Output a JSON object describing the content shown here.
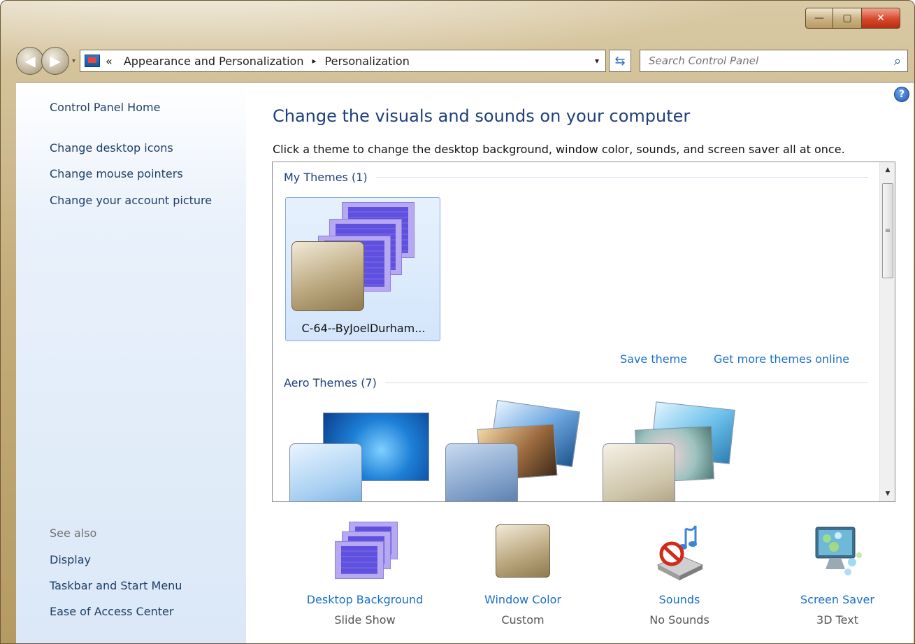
{
  "window": {
    "caption_min": "—",
    "caption_max": "▢",
    "caption_close": "✕"
  },
  "navbar": {
    "back_glyph": "◀",
    "forward_glyph": "▶",
    "history_glyph": "▾",
    "breadcrumb_overflow": "«",
    "breadcrumb": [
      "Appearance and Personalization",
      "Personalization"
    ],
    "breadcrumb_chevron": "▸",
    "address_dropdown_glyph": "▾",
    "refresh_glyph": "⇆",
    "search_placeholder": "Search Control Panel",
    "search_glyph": "⌕"
  },
  "sidebar": {
    "home": "Control Panel Home",
    "links": [
      "Change desktop icons",
      "Change mouse pointers",
      "Change your account picture"
    ],
    "see_also_label": "See also",
    "see_also": [
      "Display",
      "Taskbar and Start Menu",
      "Ease of Access Center"
    ]
  },
  "main": {
    "help_glyph": "?",
    "title": "Change the visuals and sounds on your computer",
    "instructions": "Click a theme to change the desktop background, window color, sounds, and screen saver all at once.",
    "my_themes": {
      "heading": "My Themes (1)",
      "theme_name": "C-64--ByJoelDurham..."
    },
    "save_theme": "Save theme",
    "get_more_themes": "Get more themes online",
    "aero_themes": {
      "heading": "Aero Themes (7)"
    },
    "scroll_up_glyph": "▲",
    "scroll_down_glyph": "▼",
    "scroll_grip_glyph": "≡",
    "bottom": [
      {
        "label": "Desktop Background",
        "value": "Slide Show",
        "icon": "desktop-background-icon"
      },
      {
        "label": "Window Color",
        "value": "Custom",
        "icon": "window-color-icon"
      },
      {
        "label": "Sounds",
        "value": "No Sounds",
        "icon": "sounds-icon"
      },
      {
        "label": "Screen Saver",
        "value": "3D Text",
        "icon": "screen-saver-icon"
      }
    ]
  }
}
